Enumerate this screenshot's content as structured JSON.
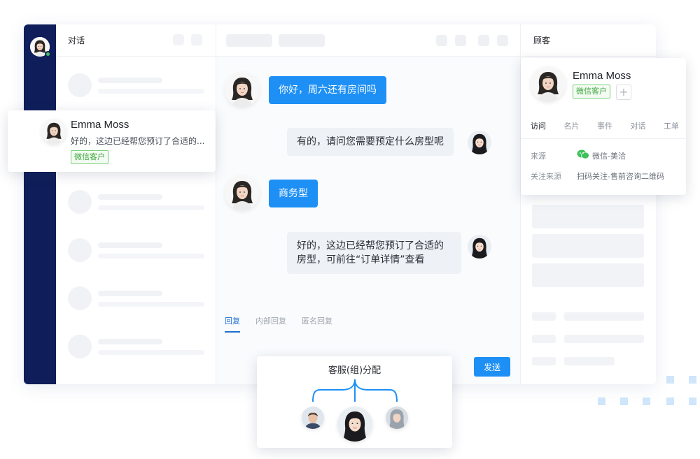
{
  "conversations": {
    "title": "对话",
    "highlight": {
      "name": "Emma Moss",
      "preview": "好的，这边已经帮您预订了合适的...",
      "tag": "微信客户"
    }
  },
  "chat": {
    "messages": [
      {
        "from": "customer",
        "text": "你好，周六还有房间吗"
      },
      {
        "from": "agent",
        "text": "有的，请问您需要预定什么房型呢"
      },
      {
        "from": "customer",
        "text": "商务型"
      },
      {
        "from": "agent",
        "line1": "好的，这边已经帮您预订了合适的",
        "line2": "房型，可前往“订单详情”查看"
      }
    ],
    "reply_tabs": [
      "回复",
      "内部回复",
      "匿名回复"
    ],
    "send_label": "发送"
  },
  "customer": {
    "title": "顾客",
    "name": "Emma Moss",
    "tag": "微信客户",
    "add_label": "+",
    "tabs": [
      "访问",
      "名片",
      "事件",
      "对话",
      "工单"
    ],
    "source_label": "来源",
    "source_value": "微信-美洽",
    "follow_label": "关注来源",
    "follow_value": "扫码关注-售前咨询二维码"
  },
  "assign": {
    "title": "客服(组)分配"
  },
  "colors": {
    "rail": "#0f1e5a",
    "accent": "#1e90f5",
    "tag_green": "#3ba63b"
  }
}
